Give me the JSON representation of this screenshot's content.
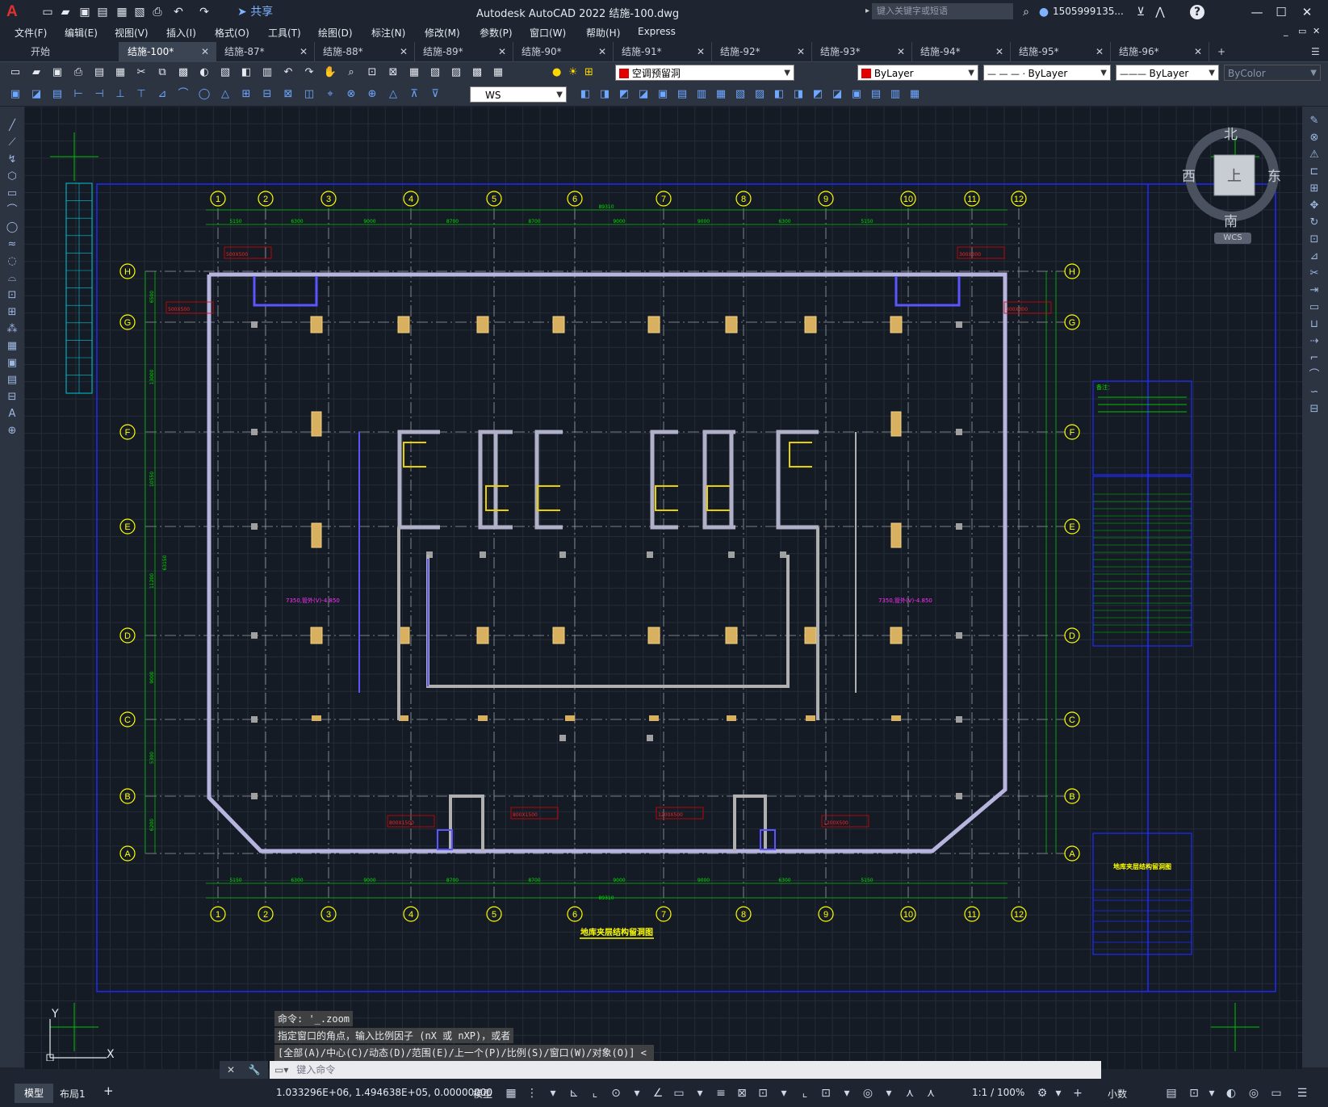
{
  "titlebar": {
    "app_logo": "A",
    "share_label": "共享",
    "title": "Autodesk AutoCAD 2022    结施-100.dwg",
    "search_placeholder": "键入关键字或短语",
    "user": "1505999135...",
    "help": "?"
  },
  "menu": [
    "文件(F)",
    "编辑(E)",
    "视图(V)",
    "插入(I)",
    "格式(O)",
    "工具(T)",
    "绘图(D)",
    "标注(N)",
    "修改(M)",
    "参数(P)",
    "窗口(W)",
    "帮助(H)",
    "Express"
  ],
  "tabs": [
    "开始",
    "结施-100*",
    "结施-87*",
    "结施-88*",
    "结施-89*",
    "结施-90*",
    "结施-91*",
    "结施-92*",
    "结施-93*",
    "结施-94*",
    "结施-95*",
    "结施-96*"
  ],
  "active_tab": 1,
  "toolbar": {
    "layer": "空调预留洞",
    "color": "ByLayer",
    "linetype": "ByLayer",
    "lineweight": "ByLayer",
    "plotstyle": "ByColor",
    "ucs": "WS"
  },
  "viewcube": {
    "north": "北",
    "south": "南",
    "east": "东",
    "west": "西",
    "top": "上",
    "wcs": "WCS"
  },
  "drawing": {
    "title": "地库夹层结构留洞图",
    "tb_title": "地库夹层结构留洞图",
    "grid_top": [
      "1",
      "2",
      "3",
      "4",
      "5",
      "6",
      "7",
      "8",
      "9",
      "10",
      "11",
      "12"
    ],
    "grid_left": [
      "H",
      "G",
      "F",
      "E",
      "D",
      "C",
      "B",
      "A"
    ],
    "dims_top_total": "89310",
    "dims_top": [
      "5150",
      "6300",
      "9000",
      "8700",
      "8700",
      "9000",
      "9000",
      "6300",
      "5150"
    ],
    "dims_bottom": [
      "5150",
      "6300",
      "9000",
      "8700",
      "8700",
      "9000",
      "9000",
      "6300",
      "5150"
    ],
    "dims_bottom_total": "89310",
    "dims_left": [
      "6500",
      "13000",
      "10550",
      "11200",
      "9000",
      "5300",
      "6200",
      "4150"
    ],
    "dims_left_total": "63150",
    "labels_red": [
      "500X500",
      "500X500",
      "300X300",
      "300X300",
      "800X1500",
      "800X1500",
      "1200X500",
      "1200X500"
    ],
    "labels_mag": [
      "7350,管外(V)-4.850",
      "7350,管外(V)-4.850"
    ],
    "note_head": "备注："
  },
  "ucs_icon": {
    "y": "Y",
    "x": "X"
  },
  "command": {
    "history": [
      "命令: '_.zoom",
      "指定窗口的角点，输入比例因子 (nX 或 nXP)，或者",
      "[全部(A)/中心(C)/动态(D)/范围(E)/上一个(P)/比例(S)/窗口(W)/对象(O)] <实时>: _e"
    ],
    "placeholder": "键入命令"
  },
  "status": {
    "model_tab": "模型",
    "layout_tab": "布局1",
    "coords": "1.033296E+06, 1.494638E+05, 0.00000000",
    "mode": "模型",
    "scale": "1:1 / 100%",
    "units": "小数"
  }
}
